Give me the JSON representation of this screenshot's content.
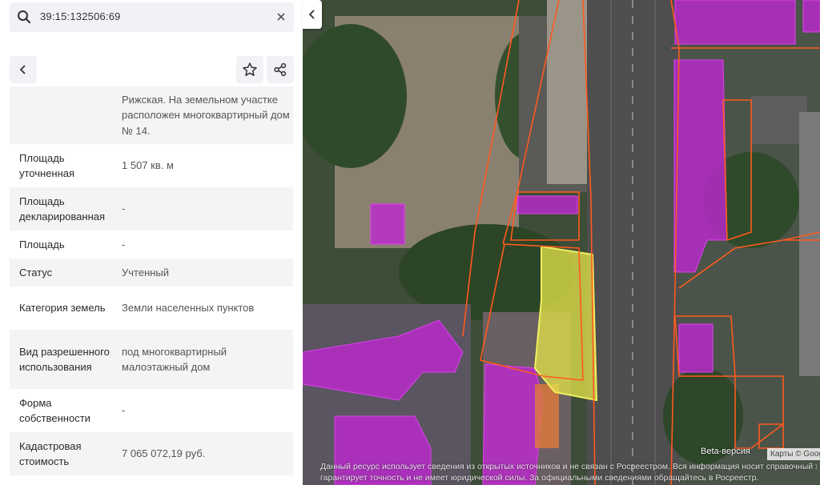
{
  "search": {
    "value": "39:15:132506:69",
    "icon": "search-icon"
  },
  "toolbar": {
    "back_icon": "arrow-left-icon",
    "star_icon": "star-icon",
    "share_icon": "share-icon"
  },
  "details": [
    {
      "label": "",
      "value": "Рижская. На земельном участке расположен многоквартирный дом № 14."
    },
    {
      "label": "Площадь уточненная",
      "value": "1 507 кв. м"
    },
    {
      "label": "Площадь декларированная",
      "value": "-"
    },
    {
      "label": "Площадь",
      "value": "-"
    },
    {
      "label": "Статус",
      "value": "Учтенный"
    },
    {
      "label": "Категория земель",
      "value": "Земли населенных пунктов"
    },
    {
      "label": "Вид разрешенного использования",
      "value": "под многоквартирный малоэтажный дом"
    },
    {
      "label": "Форма собственности",
      "value": "-"
    },
    {
      "label": "Кадастровая стоимость",
      "value": "7 065 072,19 руб."
    }
  ],
  "map": {
    "beta_label": "Beta-версия",
    "attribution": "Карты © Google",
    "disclaimer_line1": "Данный ресурс использует сведения из открытых источников и не связан с Росреестром. Вся информация носит справочный характер.",
    "disclaimer_line2": "гарантирует точность и не имеет юридической силы. За официальными сведениями обращайтесь в Росреестр.",
    "colors": {
      "parcel_selected": "#e6e64a",
      "parcel_building": "#c026d3",
      "boundary": "#ff5a1f"
    }
  }
}
